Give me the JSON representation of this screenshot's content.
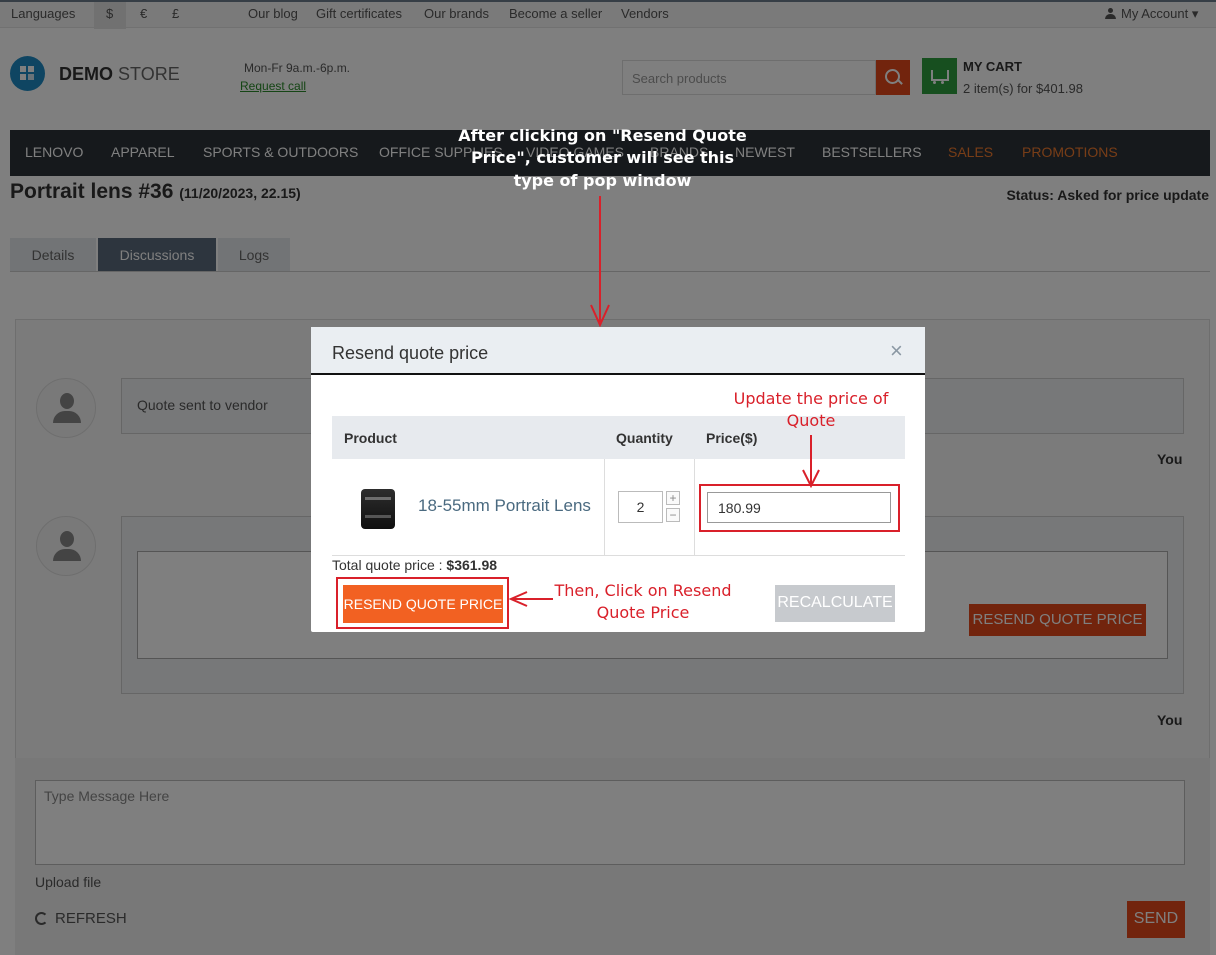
{
  "topbar": {
    "languages": "Languages",
    "currencies": [
      "$",
      "€",
      "£"
    ],
    "links": [
      "Our blog",
      "Gift certificates",
      "Our brands",
      "Become a seller",
      "Vendors"
    ],
    "account": "My Account"
  },
  "header": {
    "logo_bold": "DEMO",
    "logo_light": "STORE",
    "hours": "Mon-Fr 9a.m.-6p.m.",
    "request_call": "Request call",
    "search_placeholder": "Search products",
    "cart_title": "MY CART",
    "cart_summary": "2 item(s) for $401.98"
  },
  "nav": {
    "items": [
      "LENOVO",
      "APPAREL",
      "SPORTS & OUTDOORS",
      "OFFICE SUPPLIES",
      "VIDEO GAMES",
      "BRANDS",
      "NEWEST",
      "BESTSELLERS",
      "SALES",
      "PROMOTIONS"
    ]
  },
  "page": {
    "title": "Portrait lens #36",
    "date": "(11/20/2023, 22.15)",
    "status": "Status: Asked for price update",
    "tabs": [
      "Details",
      "Discussions",
      "Logs"
    ]
  },
  "discussion": {
    "message1": "Quote sent to vendor",
    "you_label": "You",
    "resend_label": "RESEND QUOTE PRICE",
    "message_placeholder": "Type Message Here",
    "upload": "Upload file",
    "refresh": "REFRESH",
    "send": "SEND"
  },
  "modal": {
    "title": "Resend quote price",
    "close": "×",
    "headers": [
      "Product",
      "Quantity",
      "Price($)"
    ],
    "product_name": "18-55mm Portrait Lens",
    "quantity": "2",
    "plus": "+",
    "minus": "−",
    "price": "180.99",
    "total_label": "Total quote price : ",
    "total_value": "$361.98",
    "resend_button": "RESEND QUOTE PRICE",
    "recalc_button": "RECALCULATE"
  },
  "annotations": {
    "top": "After clicking on \"Resend Quote Price\", customer will see this type of pop window",
    "price": "Update the price of Quote",
    "click": "Then, Click on Resend Quote Price"
  },
  "colors": {
    "accent": "#e5491a",
    "annotation_red": "#d9202a",
    "nav_bg": "#2c3338",
    "cart_green": "#2f9e3e"
  }
}
